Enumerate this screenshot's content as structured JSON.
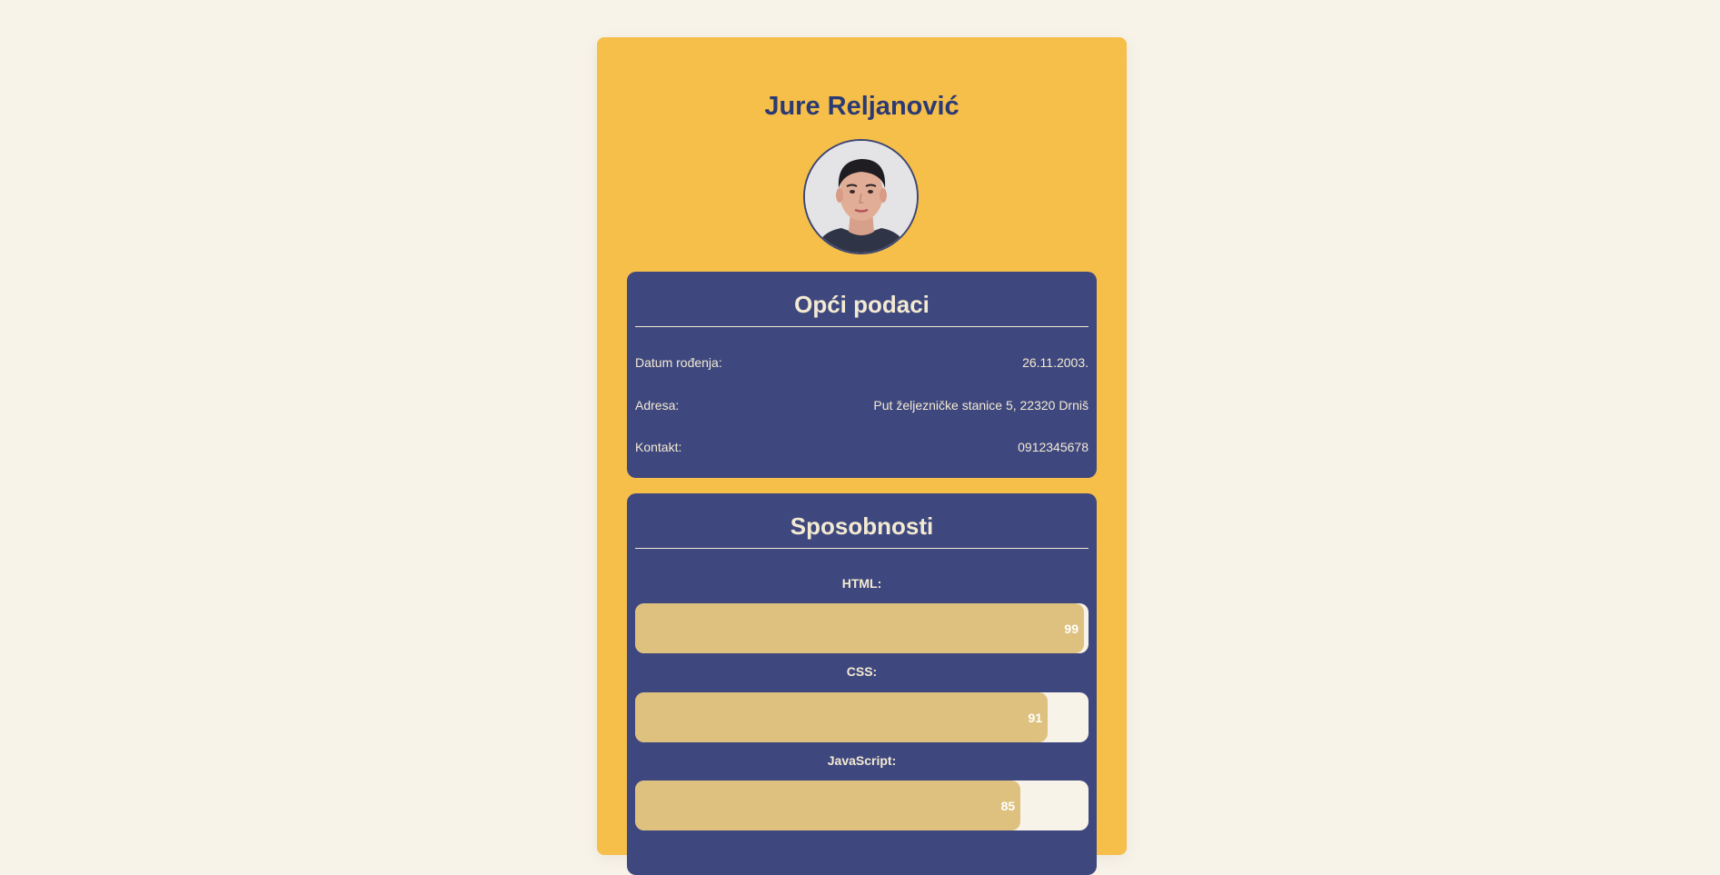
{
  "colors": {
    "page_background": "#f8f3e8",
    "card_background": "#f6bf4a",
    "section_background": "#3f487e",
    "name_color": "#2c3a73",
    "section_text": "#f3ead3",
    "bar_fill": "#dec17e",
    "bar_track": "#f8f3e8"
  },
  "profile": {
    "name": "Jure Reljanović",
    "photo_icon": "avatar-photo-icon"
  },
  "general": {
    "title": "Opći podaci",
    "rows": [
      {
        "label": "Datum rođenja:",
        "value": "26.11.2003."
      },
      {
        "label": "Adresa:",
        "value": "Put željezničke stanice 5, 22320 Drniš"
      },
      {
        "label": "Kontakt:",
        "value": "0912345678"
      }
    ]
  },
  "skills": {
    "title": "Sposobnosti",
    "items": [
      {
        "label": "HTML:",
        "value": 99,
        "display": "99"
      },
      {
        "label": "CSS:",
        "value": 91,
        "display": "91"
      },
      {
        "label": "JavaScript:",
        "value": 85,
        "display": "85"
      }
    ]
  }
}
